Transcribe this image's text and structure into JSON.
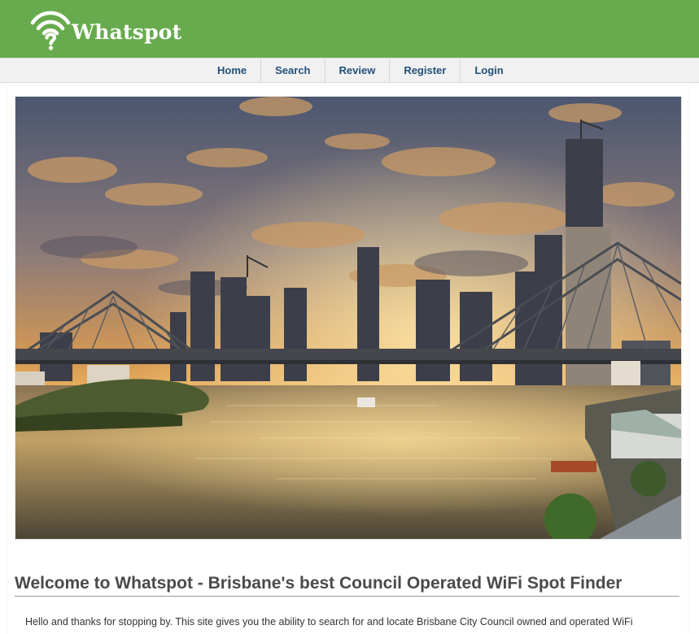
{
  "header": {
    "brand": "Whatspot",
    "logo_icon": "wifi-question-icon",
    "background": "#68ab4e"
  },
  "nav": {
    "items": [
      {
        "label": "Home"
      },
      {
        "label": "Search"
      },
      {
        "label": "Review"
      },
      {
        "label": "Register"
      },
      {
        "label": "Login"
      }
    ],
    "link_color": "#22507a"
  },
  "hero": {
    "image": "brisbane-skyline-photo"
  },
  "main": {
    "title": "Welcome to Whatspot - Brisbane's best Council Operated WiFi Spot Finder",
    "intro": "Hello and thanks for stopping by. This site gives you the ability to search for and locate Brisbane City Council owned and operated WiFi"
  }
}
